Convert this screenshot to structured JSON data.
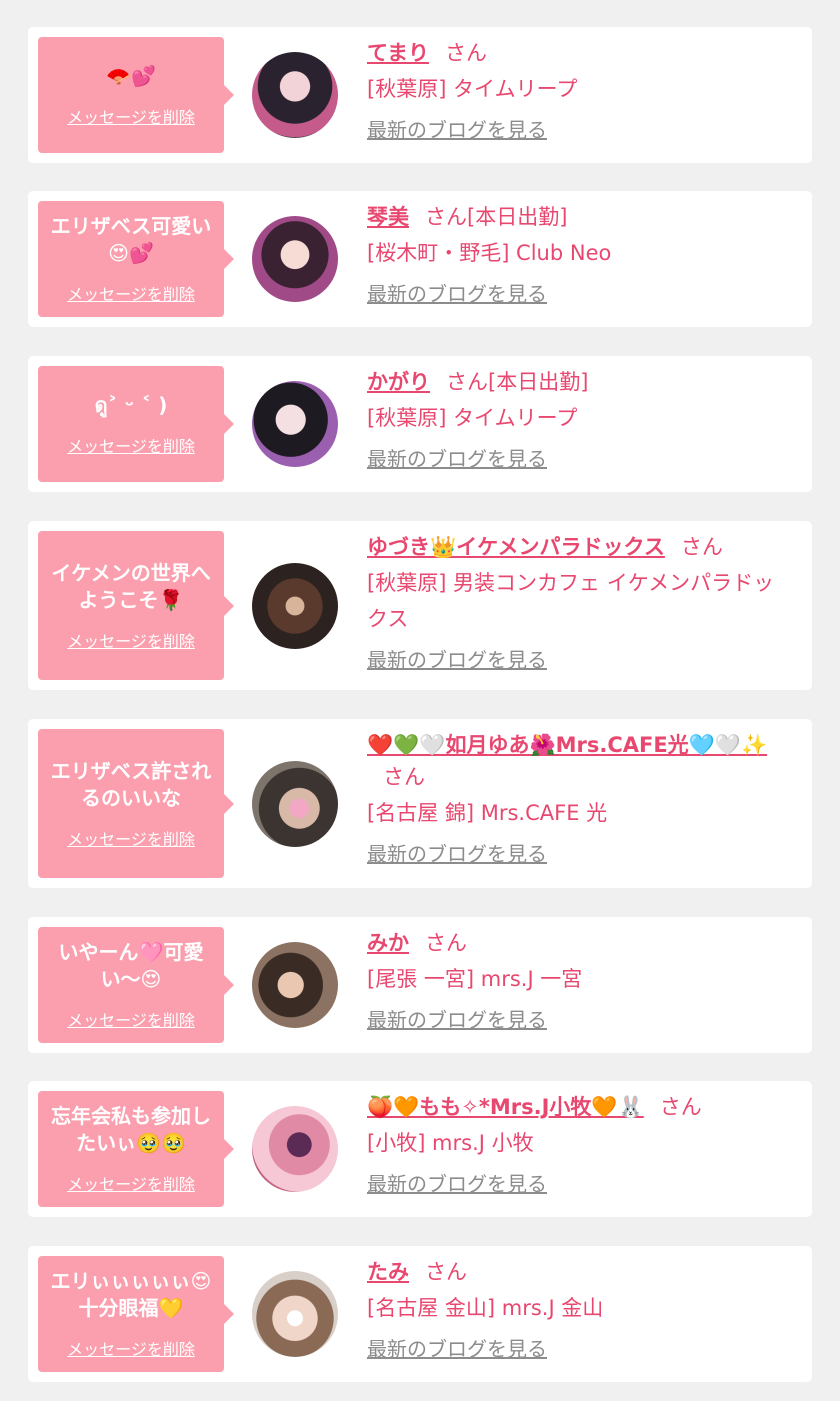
{
  "delete_label": "メッセージを削除",
  "san_label": "さん",
  "blog_label": "最新のブログを見る",
  "colors": {
    "accent": "#e8486f",
    "bubble": "#fb9fae",
    "background": "#f1f0f0",
    "link_gray": "#8c8c8c"
  },
  "items": [
    {
      "message": "🪭💕",
      "name": "てまり",
      "suffix": "さん",
      "shop": "[秋葉原] タイムリープ"
    },
    {
      "message": "エリザベス可愛い\n😍💕",
      "name": "琴美",
      "suffix": "さん[本日出勤]",
      "shop": "[桜木町・野毛] Club Neo"
    },
    {
      "message": "ดู˃ ᵕ ˂ )",
      "name": "かがり",
      "suffix": "さん[本日出勤]",
      "shop": "[秋葉原] タイムリープ"
    },
    {
      "message": "イケメンの世界へ\nようこそ🌹",
      "name": "ゆづき👑イケメンパラドックス",
      "suffix": "さん",
      "shop": "[秋葉原] 男装コンカフェ イケメンパラドックス"
    },
    {
      "message": "エリザベス許され\nるのいいな",
      "name": "❤️💚🤍如月ゆあ🌺Mrs.CAFE光🩵🤍✨",
      "suffix": "さん",
      "shop": "[名古屋 錦] Mrs.CAFE 光"
    },
    {
      "message": "いやーん🩷可愛\nい〜😍",
      "name": "みか",
      "suffix": "さん",
      "shop": "[尾張 一宮] mrs.J 一宮"
    },
    {
      "message": "忘年会私も参加し\nたいぃ🥹🥹",
      "name": "🍑🧡もも✧*Mrs.J小牧🧡🐰",
      "suffix": "さん",
      "shop": "[小牧] mrs.J 小牧"
    },
    {
      "message": "エリぃぃぃぃぃ😍\n十分眼福💛",
      "name": "たみ",
      "suffix": "さん",
      "shop": "[名古屋 金山] mrs.J 金山"
    }
  ]
}
